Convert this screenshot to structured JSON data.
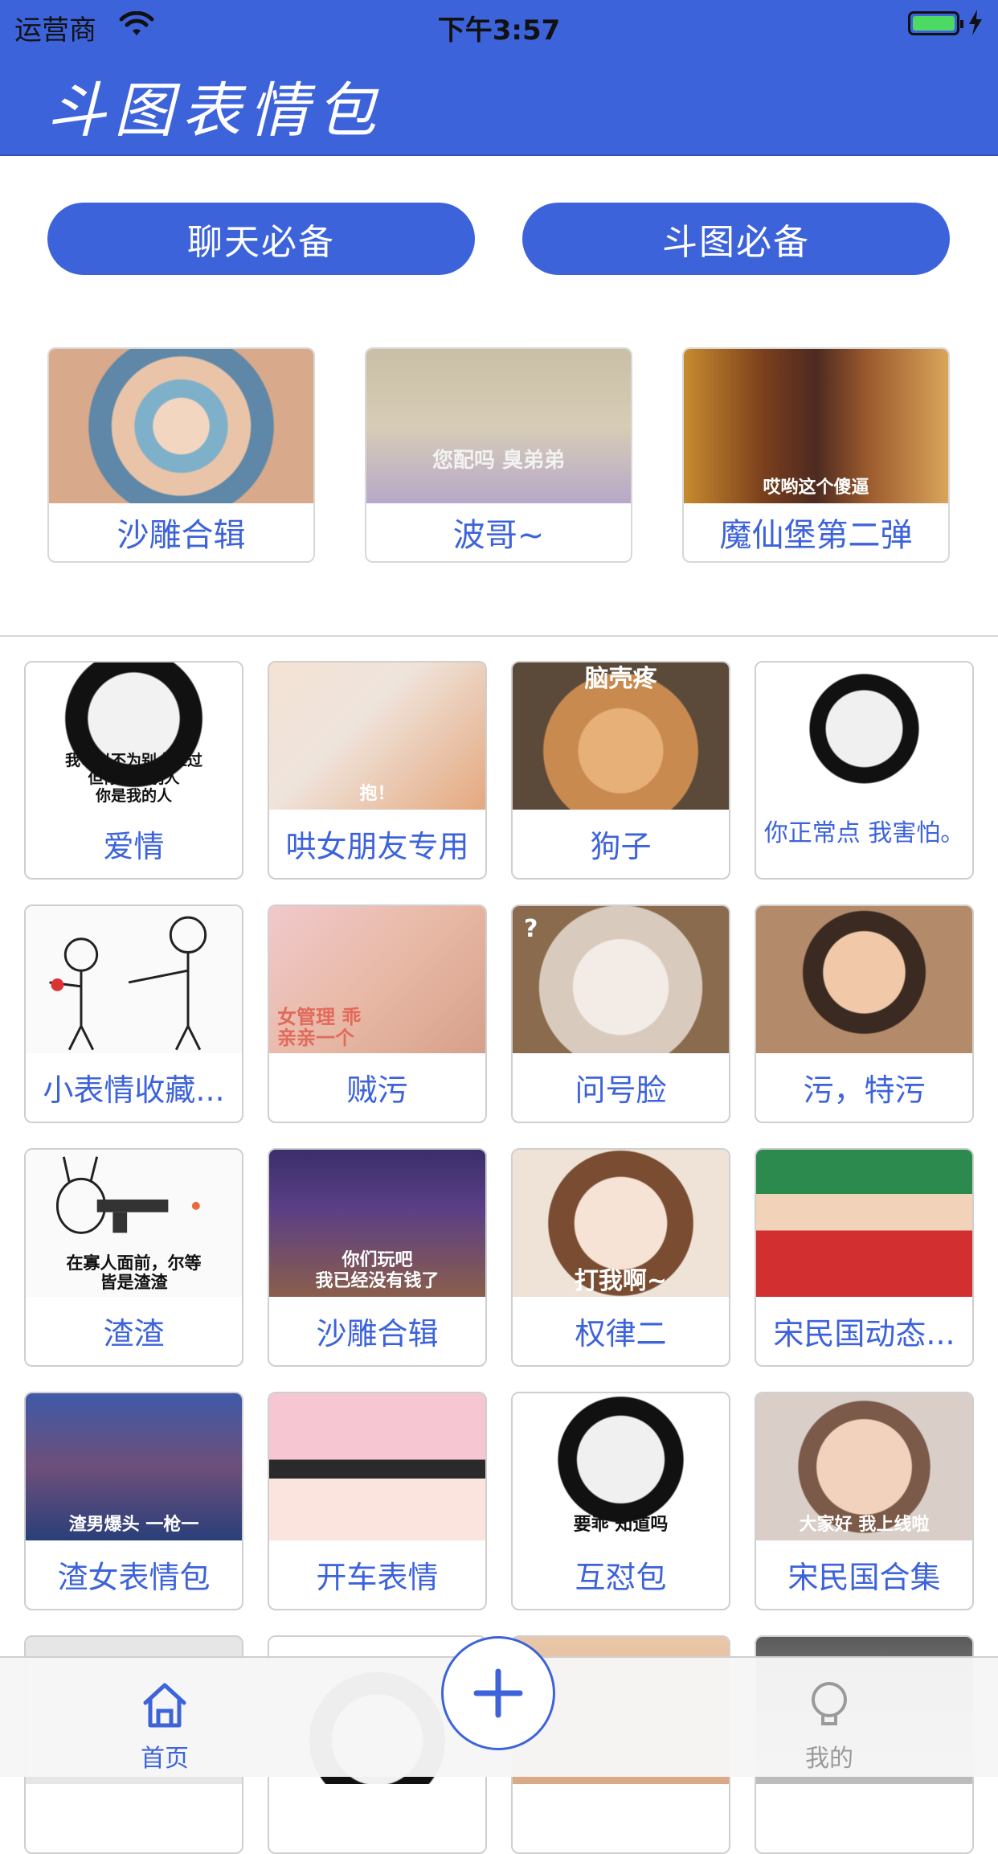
{
  "status_bar": {
    "carrier": "运营商",
    "time": "下午3:57"
  },
  "nav": {
    "title": "斗图表情包"
  },
  "top_buttons": [
    {
      "label": "聊天必备"
    },
    {
      "label": "斗图必备"
    }
  ],
  "featured": [
    {
      "label": "沙雕合辑",
      "image_caption": ""
    },
    {
      "label": "波哥~",
      "image_caption": "您配吗 臭弟弟"
    },
    {
      "label": "魔仙堡第二弹",
      "image_caption": "哎哟这个傻逼"
    }
  ],
  "grid": [
    {
      "label": "爱情",
      "image_caption": "我可以不为别人难过\n但你不是别人\n你是我的人"
    },
    {
      "label": "哄女朋友专用",
      "image_caption": "抱！"
    },
    {
      "label": "狗子",
      "image_caption": "脑壳疼"
    },
    {
      "label": "你正常点 我害怕。",
      "image_caption": ""
    },
    {
      "label": "小表情收藏...",
      "image_caption": ""
    },
    {
      "label": "贼污",
      "image_caption": "女管理 乖\n亲亲一个"
    },
    {
      "label": "问号脸",
      "image_caption": "?"
    },
    {
      "label": "污，特污",
      "image_caption": ""
    },
    {
      "label": "渣渣",
      "image_caption": "在寡人面前，尔等\n皆是渣渣"
    },
    {
      "label": "沙雕合辑",
      "image_caption": "你们玩吧\n我已经没有钱了"
    },
    {
      "label": "权律二",
      "image_caption": "打我啊~"
    },
    {
      "label": "宋民国动态...",
      "image_caption": ""
    },
    {
      "label": "渣女表情包",
      "image_caption": "渣男爆头 一枪一"
    },
    {
      "label": "开车表情",
      "image_caption": ""
    },
    {
      "label": "互怼包",
      "image_caption": "要乖 知道吗"
    },
    {
      "label": "宋民国合集",
      "image_caption": "大家好 我上线啦"
    }
  ],
  "tabbar": {
    "home_label": "首页",
    "me_label": "我的"
  },
  "icons": {
    "home": "home-icon",
    "add": "plus-icon",
    "me": "lightbulb-icon",
    "wifi": "wifi-icon",
    "battery": "battery-icon",
    "charging": "bolt-icon"
  },
  "colors": {
    "brand_blue": "#3d63db",
    "battery_green": "#4cd964"
  }
}
